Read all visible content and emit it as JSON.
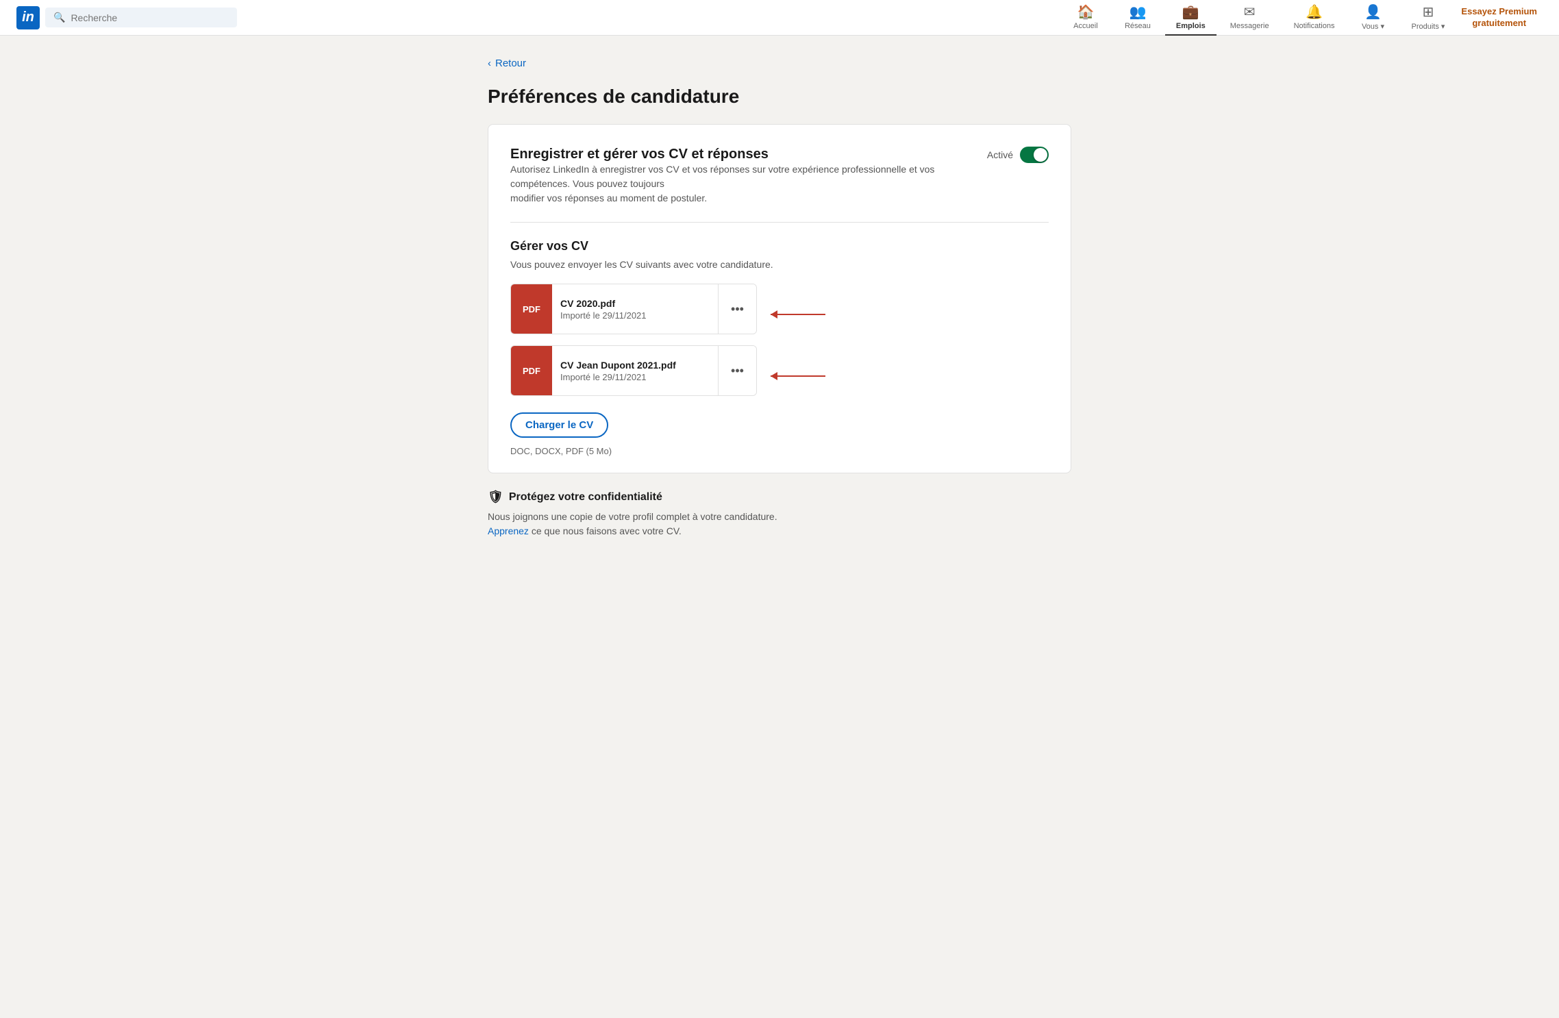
{
  "navbar": {
    "logo_text": "in",
    "search_placeholder": "Recherche",
    "nav_items": [
      {
        "id": "accueil",
        "label": "Accueil",
        "icon": "🏠",
        "active": false
      },
      {
        "id": "reseau",
        "label": "Réseau",
        "icon": "👥",
        "active": false
      },
      {
        "id": "emplois",
        "label": "Emplois",
        "icon": "💼",
        "active": true
      },
      {
        "id": "messagerie",
        "label": "Messagerie",
        "icon": "✉",
        "active": false
      },
      {
        "id": "notifications",
        "label": "Notifications",
        "icon": "🔔",
        "active": false
      },
      {
        "id": "vous",
        "label": "Vous ▾",
        "icon": "👤",
        "active": false
      },
      {
        "id": "produits",
        "label": "Produits ▾",
        "icon": "⋮⋮⋮",
        "active": false
      }
    ],
    "premium_label": "Essayez Premium\ngratuitement"
  },
  "page": {
    "back_label": "Retour",
    "title": "Préférences de candidature"
  },
  "card": {
    "section1": {
      "title": "Enregistrer et gérer vos CV et réponses",
      "description": "Autorisez LinkedIn à enregistrer vos CV et vos réponses sur votre expérience professionnelle et vos compétences. Vous pouvez toujours\nmodifier vos réponses au moment de postuler.",
      "toggle_label": "Activé",
      "toggle_on": true
    },
    "section2": {
      "title": "Gérer vos CV",
      "description": "Vous pouvez envoyer les CV suivants avec votre candidature.",
      "cv_items": [
        {
          "id": "cv1",
          "badge": "PDF",
          "name": "CV 2020.pdf",
          "date": "Importé le 29/11/2021",
          "menu_icon": "•••"
        },
        {
          "id": "cv2",
          "badge": "PDF",
          "name": "CV Jean Dupont 2021.pdf",
          "date": "Importé le 29/11/2021",
          "menu_icon": "•••"
        }
      ],
      "upload_btn_label": "Charger le CV",
      "file_types": "DOC, DOCX, PDF (5 Mo)"
    },
    "section3": {
      "title": "Protégez votre confidentialité",
      "icon": "🛡",
      "description": "Nous joignons une copie de votre profil complet à votre candidature.",
      "link_text": "Apprenez",
      "link_suffix": " ce que nous faisons avec votre CV."
    }
  }
}
